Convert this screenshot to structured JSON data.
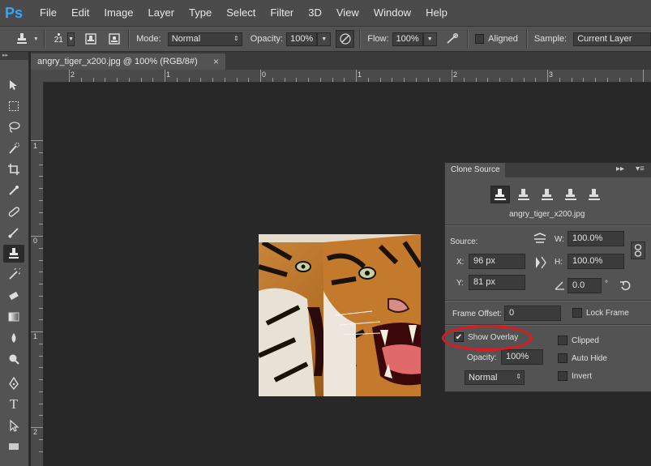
{
  "app": {
    "logo": "Ps"
  },
  "menu": [
    "File",
    "Edit",
    "Image",
    "Layer",
    "Type",
    "Select",
    "Filter",
    "3D",
    "View",
    "Window",
    "Help"
  ],
  "options": {
    "brush_size": "21",
    "mode_label": "Mode:",
    "mode_value": "Normal",
    "opacity_label": "Opacity:",
    "opacity_value": "100%",
    "flow_label": "Flow:",
    "flow_value": "100%",
    "aligned_label": "Aligned",
    "sample_label": "Sample:",
    "sample_value": "Current Layer"
  },
  "document": {
    "tab_title": "angry_tiger_x200.jpg @ 100% (RGB/8#)",
    "close_glyph": "×"
  },
  "rulers": {
    "top": [
      "2",
      "1",
      "0",
      "1",
      "2",
      "3"
    ],
    "left": [
      "1",
      "0",
      "1",
      "2"
    ]
  },
  "clone_source": {
    "title": "Clone Source",
    "file": "angry_tiger_x200.jpg",
    "source_label": "Source:",
    "x_label": "X:",
    "x_value": "96 px",
    "y_label": "Y:",
    "y_value": "81 px",
    "w_label": "W:",
    "w_value": "100.0%",
    "h_label": "H:",
    "h_value": "100.0%",
    "angle_value": "0.0",
    "angle_unit": "°",
    "frame_offset_label": "Frame Offset:",
    "frame_offset_value": "0",
    "lock_frame_label": "Lock Frame",
    "show_overlay_label": "Show Overlay",
    "show_overlay_checked": true,
    "overlay_opacity_label": "Opacity:",
    "overlay_opacity_value": "100%",
    "clipped_label": "Clipped",
    "auto_hide_label": "Auto Hide",
    "blend_value": "Normal",
    "invert_label": "Invert"
  },
  "colors": {
    "highlight_ring": "#e3171d",
    "ps_blue": "#31a8ff"
  }
}
